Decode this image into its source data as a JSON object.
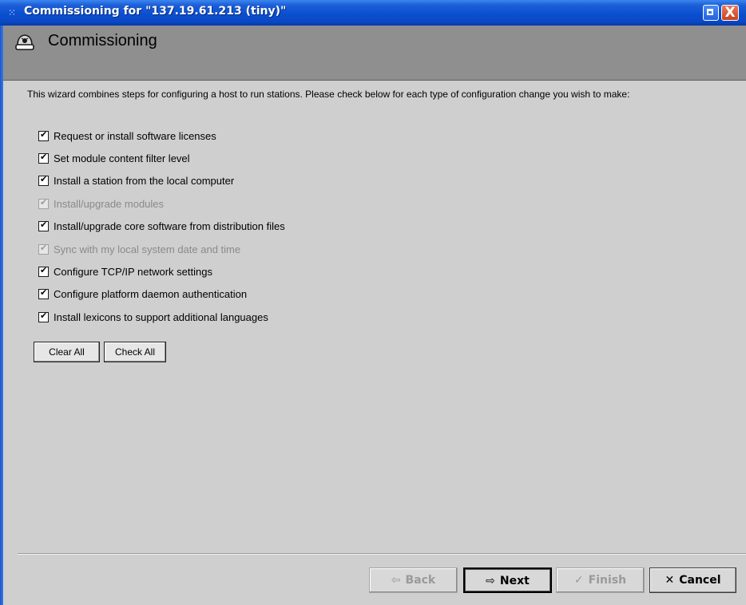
{
  "window": {
    "title": "Commissioning for \"137.19.61.213 (tiny)\"",
    "title_icon": "app-dots-icon",
    "restore_icon": "restore-icon",
    "close_icon": "close-icon",
    "close_glyph": "X"
  },
  "header": {
    "icon": "commissioning-wizard-icon",
    "title": "Commissioning"
  },
  "intro": {
    "text": "This wizard combines steps for configuring a host to run stations.  Please check below for each type of configuration change you wish to make:"
  },
  "options": [
    {
      "label": "Request or install software licenses",
      "checked": true,
      "enabled": true
    },
    {
      "label": "Set module content filter level",
      "checked": true,
      "enabled": true
    },
    {
      "label": "Install a station from the local computer",
      "checked": true,
      "enabled": true
    },
    {
      "label": "Install/upgrade modules",
      "checked": true,
      "enabled": false
    },
    {
      "label": "Install/upgrade core software from distribution files",
      "checked": true,
      "enabled": true
    },
    {
      "label": "Sync with my local system date and time",
      "checked": true,
      "enabled": false
    },
    {
      "label": "Configure TCP/IP network settings",
      "checked": true,
      "enabled": true
    },
    {
      "label": "Configure platform daemon authentication",
      "checked": true,
      "enabled": true
    },
    {
      "label": "Install lexicons to support additional languages",
      "checked": true,
      "enabled": true
    }
  ],
  "selection_buttons": {
    "clear_all": "Clear All",
    "check_all": "Check All"
  },
  "wizard_buttons": {
    "back": {
      "label": "Back",
      "glyph": "⇦",
      "enabled": false
    },
    "next": {
      "label": "Next",
      "glyph": "⇨",
      "enabled": true
    },
    "finish": {
      "label": "Finish",
      "glyph": "✓",
      "enabled": false
    },
    "cancel": {
      "label": "Cancel",
      "glyph": "✕",
      "enabled": true
    }
  }
}
